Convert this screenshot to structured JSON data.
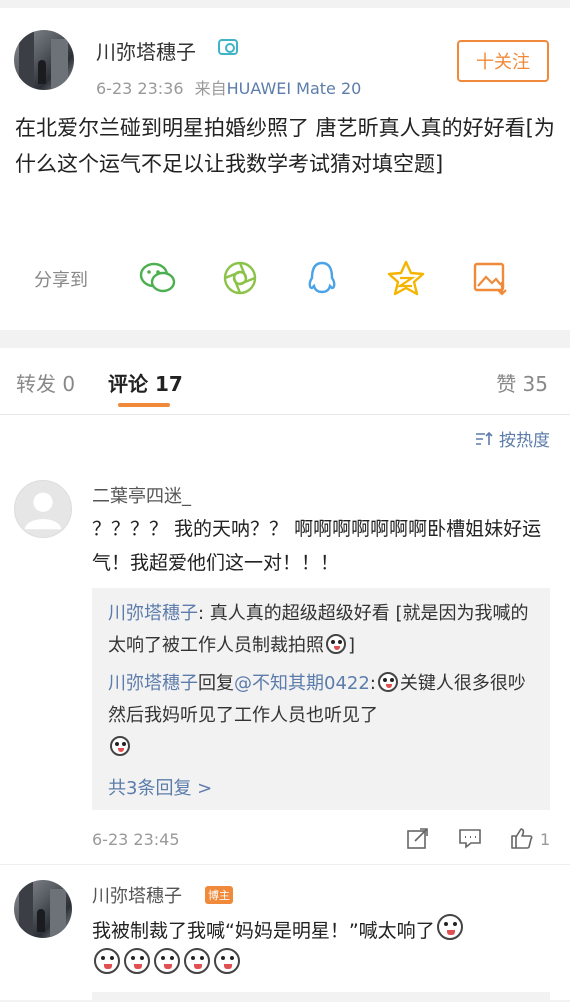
{
  "post": {
    "author": "川弥塔穗子",
    "time": "6-23 23:36",
    "source_prefix": "来自",
    "device": "HUAWEI Mate 20",
    "follow_label": "十关注",
    "text": "在北爱尔兰碰到明星拍婚纱照了 唐艺昕真人真的好好看[为什么这个运气不足以让我数学考试猜对填空题]",
    "share_label": "分享到"
  },
  "tabs": {
    "repost": "转发 0",
    "comments": "评论 17",
    "likes": "赞 35"
  },
  "sort_label": "按热度",
  "comment1": {
    "name": "二葉亭四迷_",
    "text": "？？？？ 我的天呐？？ 啊啊啊啊啊啊啊卧槽姐妹好运气！我超爱他们这一对！！！",
    "reply1_author": "川弥塔穗子",
    "reply1_text": ": 真人真的超级超级好看 [就是因为我喊的太响了被工作人员制裁拍照",
    "reply1_end": "]",
    "reply2_author": "川弥塔穗子",
    "reply2_mid": "回复",
    "reply2_mention": "@不知其期0422",
    "reply2_text": "关键人很多很吵 然后我妈听见了工作人员也听见了",
    "more_replies": "共3条回复 >",
    "time": "6-23 23:45",
    "like_count": "1"
  },
  "comment2": {
    "name": "川弥塔穗子",
    "badge": "博主",
    "text": "我被制裁了我喊“妈妈是明星！”喊太响了"
  },
  "colors": {
    "accent": "#f08a3a",
    "link": "#5c7cab"
  }
}
